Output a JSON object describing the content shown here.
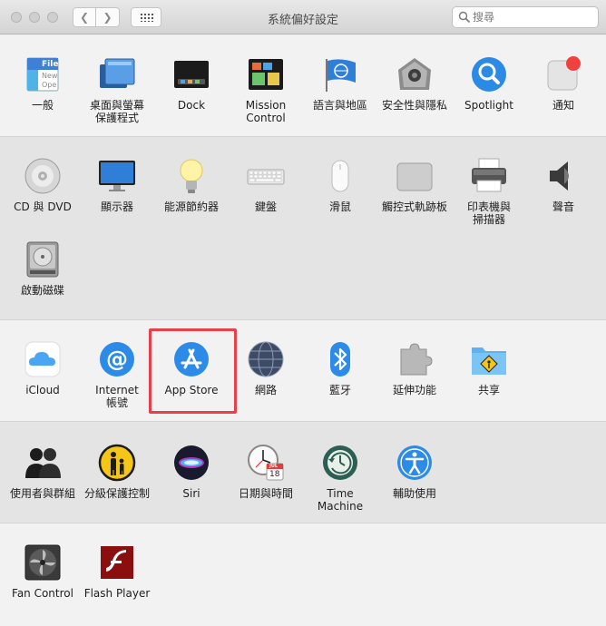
{
  "window": {
    "title": "系統偏好設定",
    "search_placeholder": "搜尋"
  },
  "sections": [
    {
      "panes": [
        {
          "label": "一般",
          "icon": "general-icon"
        },
        {
          "label": "桌面與螢幕\n保護程式",
          "icon": "desktop-icon"
        },
        {
          "label": "Dock",
          "icon": "dock-icon"
        },
        {
          "label": "Mission\nControl",
          "icon": "mission-control-icon"
        },
        {
          "label": "語言與地區",
          "icon": "language-icon"
        },
        {
          "label": "安全性與隱私",
          "icon": "security-icon"
        },
        {
          "label": "Spotlight",
          "icon": "spotlight-icon"
        },
        {
          "label": "通知",
          "icon": "notifications-icon"
        }
      ],
      "general_icon_text": [
        "File",
        "New",
        "Ope"
      ]
    },
    {
      "panes": [
        {
          "label": "CD 與 DVD",
          "icon": "cd-dvd-icon"
        },
        {
          "label": "顯示器",
          "icon": "display-icon"
        },
        {
          "label": "能源節約器",
          "icon": "energy-icon"
        },
        {
          "label": "鍵盤",
          "icon": "keyboard-icon"
        },
        {
          "label": "滑鼠",
          "icon": "mouse-icon"
        },
        {
          "label": "觸控式軌跡板",
          "icon": "trackpad-icon"
        },
        {
          "label": "印表機與\n掃描器",
          "icon": "printer-icon"
        },
        {
          "label": "聲音",
          "icon": "sound-icon"
        },
        {
          "label": "啟動磁碟",
          "icon": "startup-disk-icon"
        }
      ]
    },
    {
      "panes": [
        {
          "label": "iCloud",
          "icon": "icloud-icon"
        },
        {
          "label": "Internet\n帳號",
          "icon": "internet-accounts-icon"
        },
        {
          "label": "App Store",
          "icon": "app-store-icon"
        },
        {
          "label": "網路",
          "icon": "network-icon"
        },
        {
          "label": "藍牙",
          "icon": "bluetooth-icon"
        },
        {
          "label": "延伸功能",
          "icon": "extensions-icon"
        },
        {
          "label": "共享",
          "icon": "sharing-icon"
        }
      ]
    },
    {
      "panes": [
        {
          "label": "使用者與群組",
          "icon": "users-icon"
        },
        {
          "label": "分級保護控制",
          "icon": "parental-controls-icon"
        },
        {
          "label": "Siri",
          "icon": "siri-icon"
        },
        {
          "label": "日期與時間",
          "icon": "date-time-icon"
        },
        {
          "label": "Time Machine",
          "icon": "time-machine-icon"
        },
        {
          "label": "輔助使用",
          "icon": "accessibility-icon"
        }
      ],
      "calendar_icon_text": [
        "JUL",
        "18"
      ]
    },
    {
      "panes": [
        {
          "label": "Fan Control",
          "icon": "fan-control-icon"
        },
        {
          "label": "Flash Player",
          "icon": "flash-player-icon"
        }
      ]
    }
  ],
  "highlight_color": "#e8404a"
}
